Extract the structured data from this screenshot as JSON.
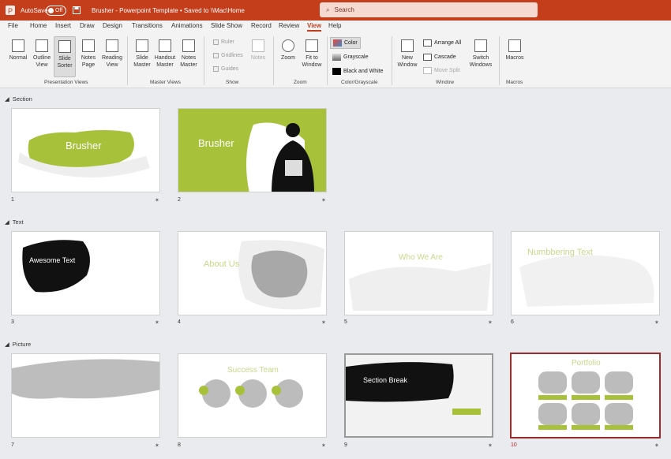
{
  "titlebar": {
    "autosave_label": "AutoSave",
    "autosave_state": "Off",
    "doc_title": "Brusher - Powerpoint Template • Saved to \\\\Mac\\Home",
    "search_placeholder": "Search"
  },
  "menu": [
    "File",
    "Home",
    "Insert",
    "Draw",
    "Design",
    "Transitions",
    "Animations",
    "Slide Show",
    "Record",
    "Review",
    "View",
    "Help"
  ],
  "active_menu": "View",
  "ribbon": {
    "presentation_views": {
      "label": "Presentation Views",
      "buttons": [
        "Normal",
        "Outline View",
        "Slide Sorter",
        "Notes Page",
        "Reading View"
      ]
    },
    "master_views": {
      "label": "Master Views",
      "buttons": [
        "Slide Master",
        "Handout Master",
        "Notes Master"
      ]
    },
    "show": {
      "label": "Show",
      "checks": [
        "Ruler",
        "Gridlines",
        "Guides"
      ],
      "notes": "Notes"
    },
    "zoom": {
      "label": "Zoom",
      "buttons": [
        "Zoom",
        "Fit to Window"
      ]
    },
    "color": {
      "label": "Color/Grayscale",
      "options": [
        "Color",
        "Grayscale",
        "Black and White"
      ]
    },
    "window": {
      "label": "Window",
      "new_window": "New Window",
      "arrange": "Arrange All",
      "cascade": "Cascade",
      "move_split": "Move Split",
      "switch": "Switch Windows"
    },
    "macros": {
      "label": "Macros",
      "button": "Macros"
    }
  },
  "sections": [
    "Section",
    "Text",
    "Picture"
  ],
  "slides": [
    {
      "num": "1",
      "title": "Brusher"
    },
    {
      "num": "2",
      "title": "Brusher"
    },
    {
      "num": "3",
      "title": "Awesome Text"
    },
    {
      "num": "4",
      "title": "About Us"
    },
    {
      "num": "5",
      "title": "Who We Are"
    },
    {
      "num": "6",
      "title": "Numbbering Text"
    },
    {
      "num": "7",
      "title": ""
    },
    {
      "num": "8",
      "title": "Success Team"
    },
    {
      "num": "9",
      "title": "Section Break"
    },
    {
      "num": "10",
      "title": "Portfolio"
    }
  ],
  "colors": {
    "accent": "#c43e1c",
    "lime": "#a7c23a",
    "selected_border": "#9b2c2c"
  }
}
